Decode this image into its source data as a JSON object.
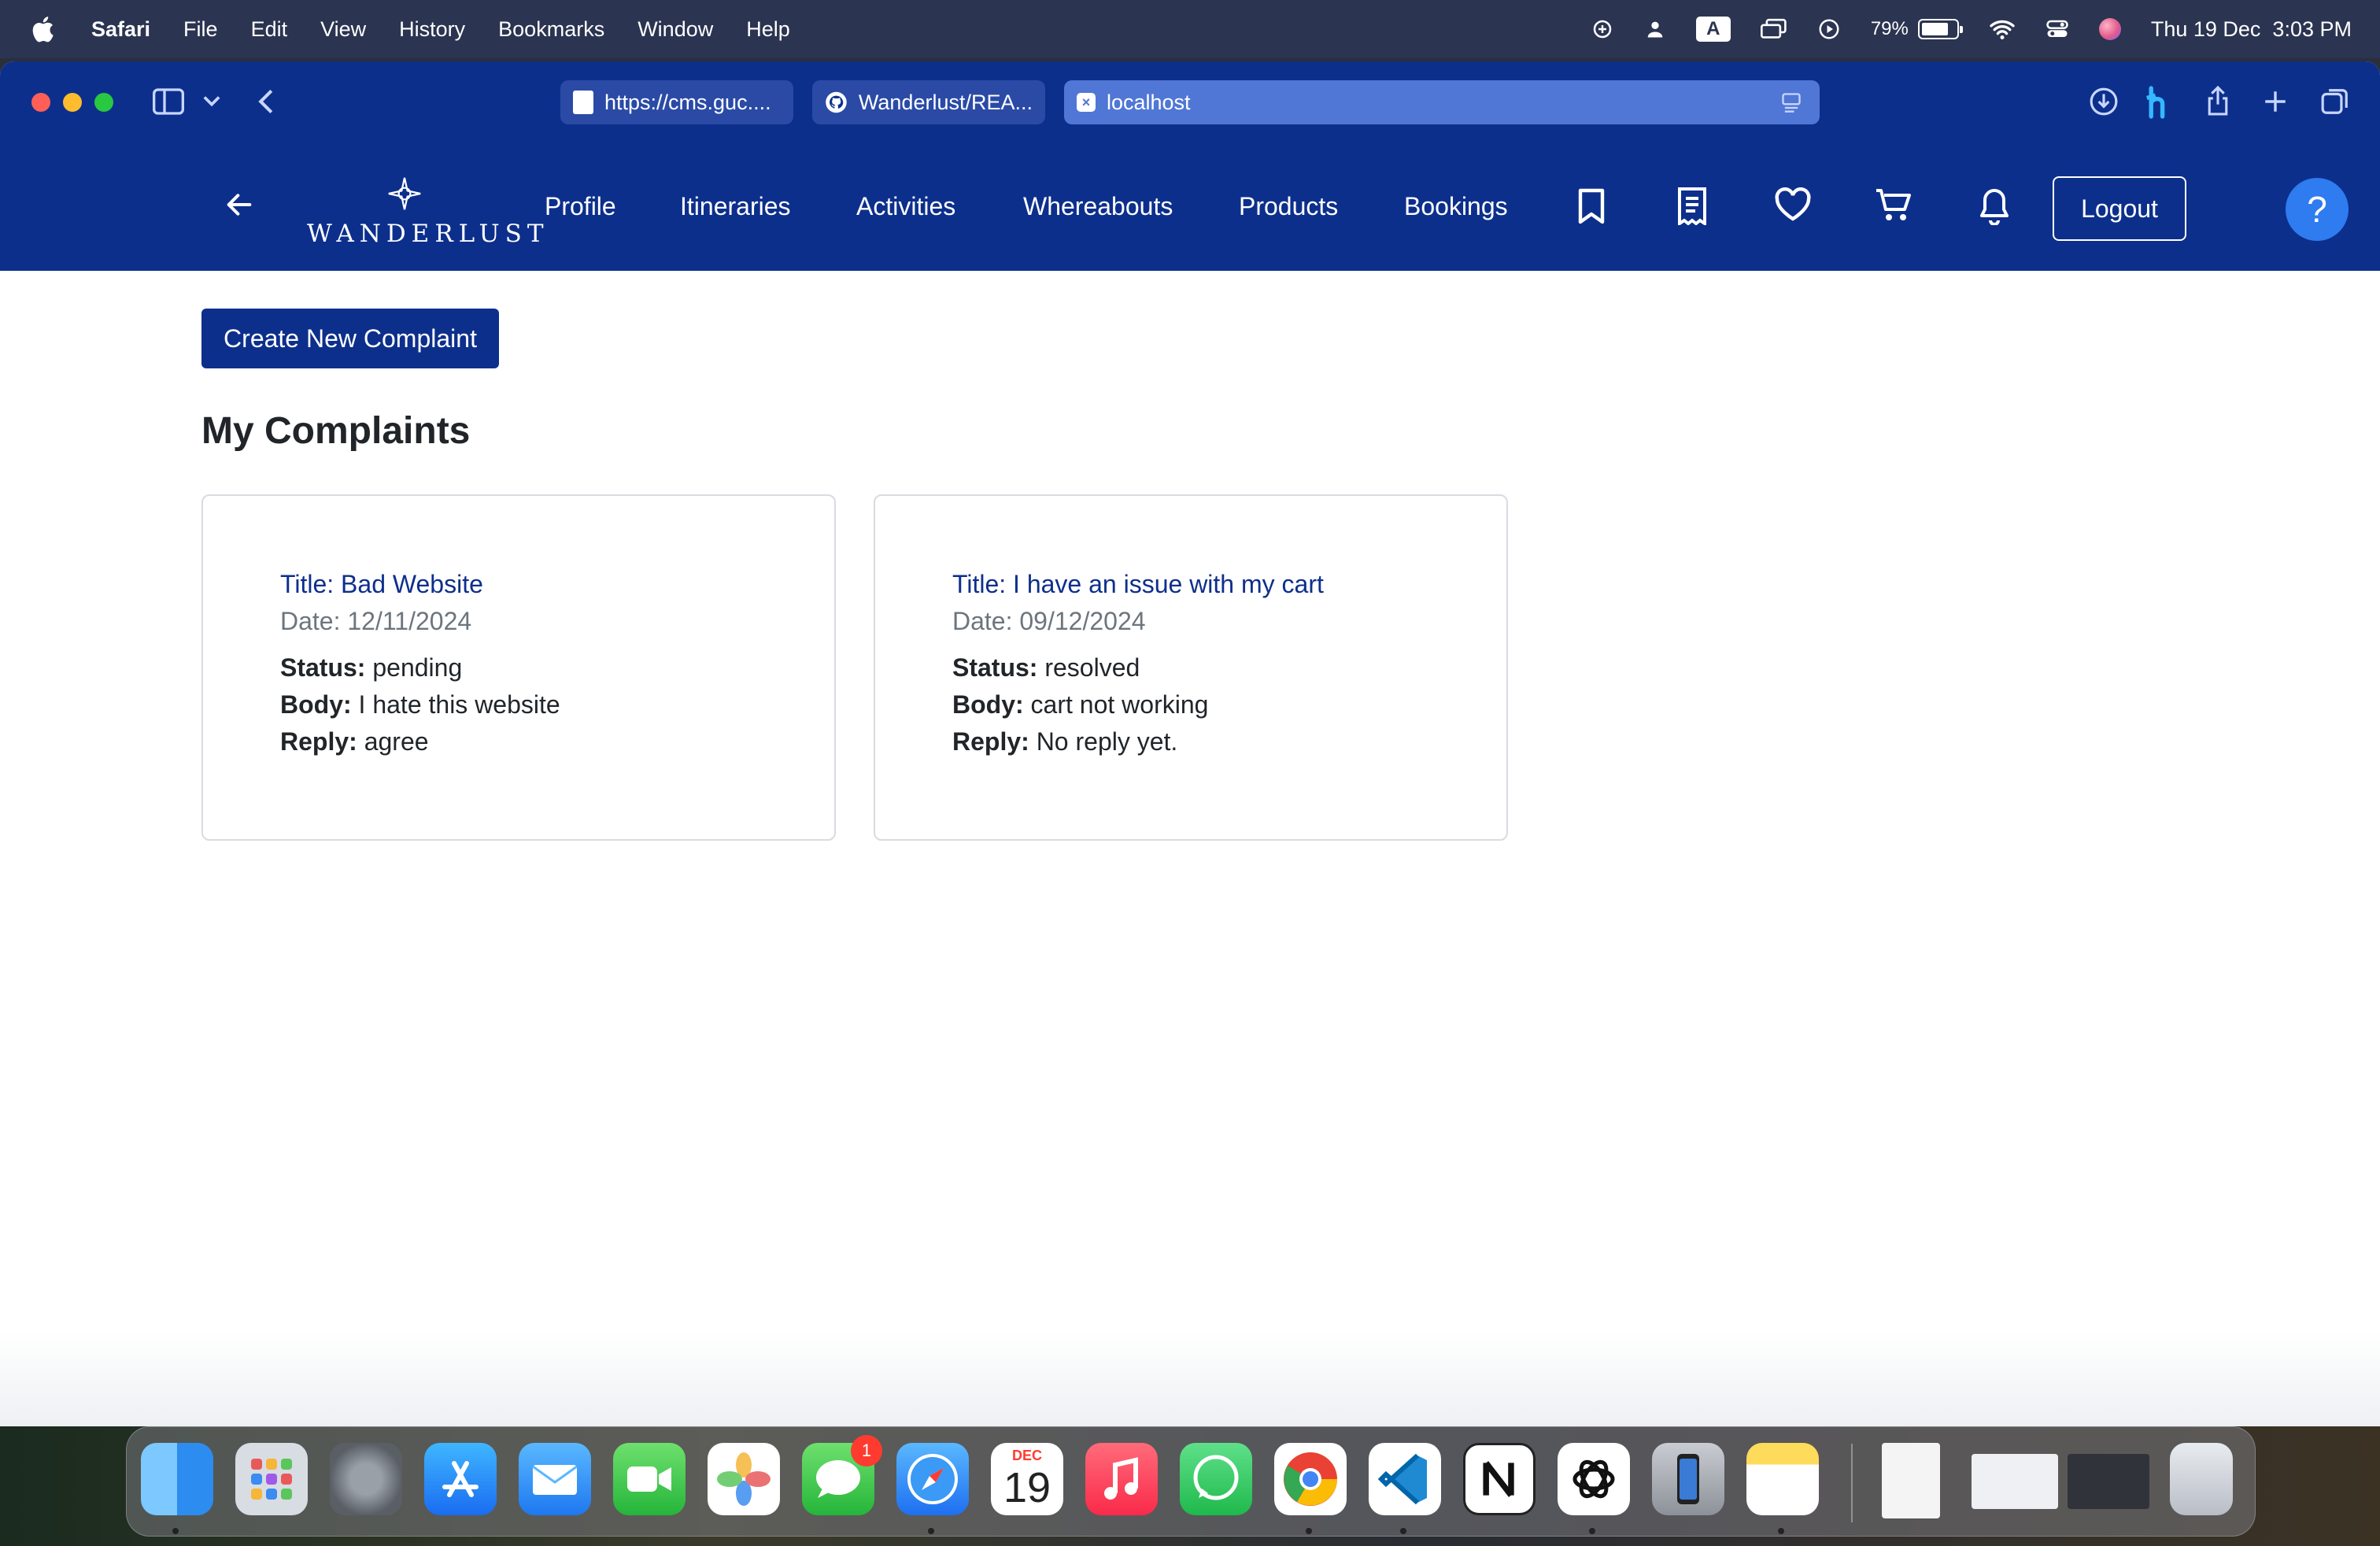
{
  "menubar": {
    "app_name": "Safari",
    "items": [
      "File",
      "Edit",
      "View",
      "History",
      "Bookmarks",
      "Window",
      "Help"
    ],
    "battery_percent": "79%",
    "battery_level": 0.79,
    "input_source": "A",
    "datetime": "Thu 19 Dec  3:03 PM"
  },
  "browser": {
    "tabs": [
      {
        "label": "https://cms.guc...."
      },
      {
        "label": "Wanderlust/REA..."
      },
      {
        "label": "localhost"
      }
    ]
  },
  "site": {
    "logo_text": "WANDERLUST",
    "nav": [
      "Profile",
      "Itineraries",
      "Activities",
      "Whereabouts",
      "Products",
      "Bookings"
    ],
    "nav_icons": [
      "bookmark-icon",
      "receipt-icon",
      "heart-icon",
      "cart-icon",
      "bell-icon"
    ],
    "logout_label": "Logout",
    "help_label": "?"
  },
  "page": {
    "create_button": "Create New Complaint",
    "section_title": "My Complaints",
    "complaints": [
      {
        "title": "Title: Bad Website",
        "date": "Date: 12/11/2024",
        "status_label": "Status:",
        "status": "pending",
        "body_label": "Body:",
        "body": "I hate this website",
        "reply_label": "Reply:",
        "reply": "agree"
      },
      {
        "title": "Title: I have an issue with my cart",
        "date": "Date: 09/12/2024",
        "status_label": "Status:",
        "status": "resolved",
        "body_label": "Body:",
        "body": "cart not working",
        "reply_label": "Reply:",
        "reply": "No reply yet."
      }
    ]
  },
  "dock": {
    "apps": [
      "Finder",
      "Launchpad",
      "System Settings",
      "App Store",
      "Mail",
      "FaceTime",
      "Photos",
      "Messages",
      "Safari",
      "Calendar",
      "Music",
      "WhatsApp",
      "Chrome",
      "VS Code",
      "Notion",
      "ChatGPT",
      "iPhone Mirroring",
      "Notes"
    ],
    "messages_badge": "1",
    "calendar_month": "DEC",
    "calendar_day": "19"
  },
  "colors": {
    "brand_blue": "#0d2f8c",
    "help_blue": "#2f7bf0"
  }
}
